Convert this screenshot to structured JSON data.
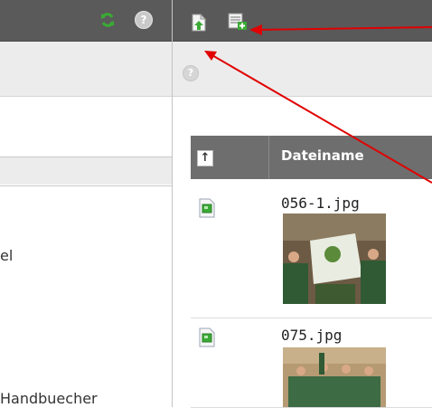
{
  "toolbar": {
    "left_icons": [
      "refresh-icon",
      "help-icon"
    ],
    "right_icons": [
      "upload-file-icon",
      "new-file-icon"
    ]
  },
  "help_glyph": "?",
  "tree": {
    "items": [
      {
        "label": "el"
      },
      {
        "label": "Handbuecher"
      }
    ]
  },
  "file_list": {
    "sort_glyph": "↑",
    "column_filename": "Dateiname",
    "rows": [
      {
        "filename": "056-1.jpg",
        "icon": "image-file-icon",
        "thumbnail": "group photo with banner"
      },
      {
        "filename": "075.jpg",
        "icon": "image-file-icon",
        "thumbnail": "group photo"
      }
    ]
  },
  "annotation_color": "#e00000"
}
